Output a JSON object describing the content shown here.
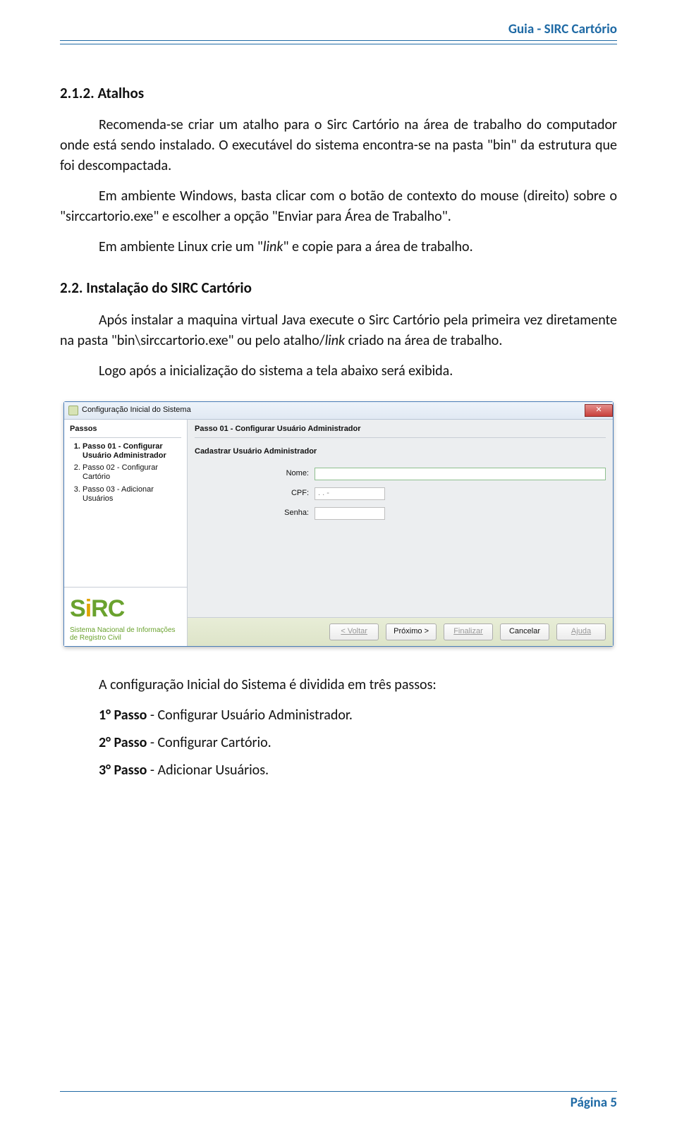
{
  "header": {
    "title": "Guia - SIRC Cartório"
  },
  "sections": {
    "s212": {
      "heading": "2.1.2.  Atalhos",
      "p1": "Recomenda-se criar um atalho para o Sirc Cartório na área de trabalho do computador onde está sendo instalado. O executável do sistema encontra-se na pasta \"bin\" da estrutura que foi descompactada.",
      "p2": "Em ambiente Windows, basta clicar com o botão de contexto do mouse (direito) sobre o \"sirccartorio.exe\" e escolher a opção \"Enviar para Área de Trabalho\".",
      "p3_prefix": "Em ambiente Linux crie um \"",
      "p3_em": "link",
      "p3_suffix": "\" e copie para a área de trabalho."
    },
    "s22": {
      "heading": "2.2. Instalação do SIRC Cartório",
      "p1_prefix": "Após instalar a maquina virtual Java execute o Sirc Cartório pela primeira vez diretamente na pasta \"bin\\sirccartorio.exe\" ou pelo atalho/",
      "p1_em": "link",
      "p1_suffix": " criado na área de trabalho.",
      "p2": "Logo após a inicialização do sistema a tela abaixo será exibida.",
      "post": "A configuração Inicial do Sistema é dividida em três passos:",
      "step1_b": "1° Passo",
      "step1_t": " - Configurar Usuário Administrador.",
      "step2_b": "2° Passo",
      "step2_t": " - Configurar Cartório.",
      "step3_b": "3° Passo",
      "step3_t": " - Adicionar Usuários."
    }
  },
  "shot": {
    "title": "Configuração Inicial do Sistema",
    "passos_head": "Passos",
    "steps": [
      "Passo 01 - Configurar Usuário Administrador",
      "Passo 02 - Configurar Cartório",
      "Passo 03 - Adicionar Usuários"
    ],
    "form_title": "Passo 01 - Configurar Usuário Administrador",
    "form_sub": "Cadastrar Usuário Administrador",
    "labels": {
      "nome": "Nome:",
      "cpf": "CPF:",
      "senha": "Senha:"
    },
    "cpf_mask": ".  .  -",
    "logo": {
      "text": "SIRC",
      "tag1": "Sistema Nacional de Informações",
      "tag2": "de Registro Civil"
    },
    "buttons": {
      "voltar": "< Voltar",
      "proximo": "Próximo >",
      "finalizar": "Finalizar",
      "cancelar": "Cancelar",
      "ajuda": "Ajuda"
    }
  },
  "footer": {
    "page": "Página 5"
  }
}
